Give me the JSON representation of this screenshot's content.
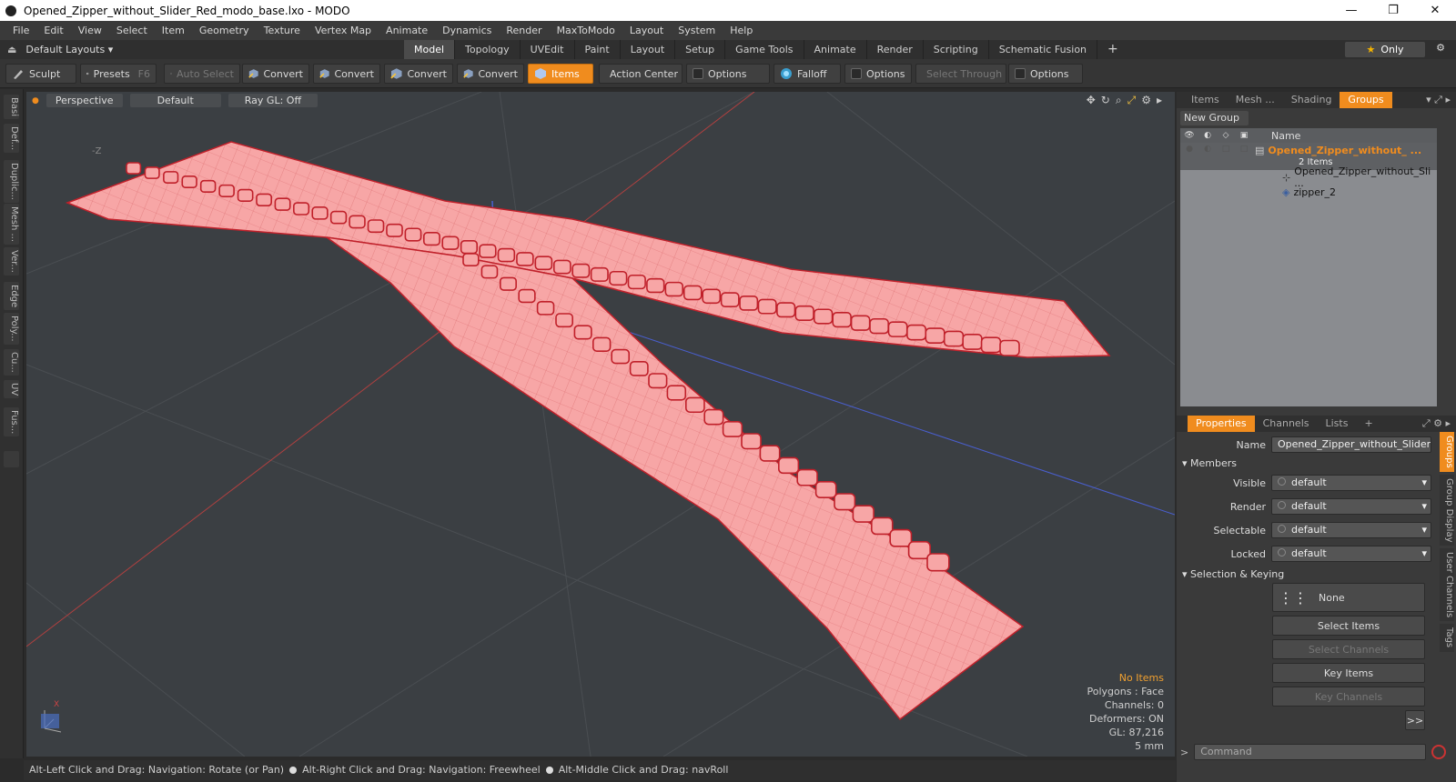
{
  "window": {
    "title": "Opened_Zipper_without_Slider_Red_modo_base.lxo - MODO",
    "minimize": "—",
    "maximize": "❐",
    "close": "✕"
  },
  "menu": [
    "File",
    "Edit",
    "View",
    "Select",
    "Item",
    "Geometry",
    "Texture",
    "Vertex Map",
    "Animate",
    "Dynamics",
    "Render",
    "MaxToModo",
    "Layout",
    "System",
    "Help"
  ],
  "layoutbar": {
    "layout_select": "Default Layouts ▾",
    "tabs": [
      "Model",
      "Topology",
      "UVEdit",
      "Paint",
      "Layout",
      "Setup",
      "Game Tools",
      "Animate",
      "Render",
      "Scripting",
      "Schematic Fusion"
    ],
    "active_tab": "Model",
    "plus": "+",
    "only_label": "Only",
    "star": "★",
    "gear": "⚙"
  },
  "toolbar": {
    "sculpt": "Sculpt",
    "presets": "Presets",
    "presets_key": "F6",
    "auto_select": "Auto Select",
    "convert1": "Convert",
    "convert2": "Convert",
    "convert3": "Convert",
    "convert4": "Convert",
    "items": "Items",
    "action_center": "Action Center",
    "options1": "Options",
    "falloff": "Falloff",
    "options2": "Options",
    "select_through": "Select Through",
    "options3": "Options"
  },
  "left_tabs": [
    "Basi",
    "Def...",
    "Duplic...",
    "Mesh ...",
    "Ver...",
    "Edge",
    "Poly...",
    "Cu...",
    "UV",
    "Fus..."
  ],
  "viewport": {
    "view": "Perspective",
    "shading": "Default",
    "raygl": "Ray GL: Off",
    "axis_label": "-Z",
    "info": {
      "no_items": "No Items",
      "polygons": "Polygons : Face",
      "channels": "Channels: 0",
      "deformers": "Deformers: ON",
      "gl": "GL: 87,216",
      "scale": "5 mm"
    },
    "mesh_color": "#f7a6a6",
    "edge_color": "#c0202a"
  },
  "status": {
    "hint1": "Alt-Left Click and Drag: Navigation: Rotate (or Pan)",
    "hint2": "Alt-Right Click and Drag: Navigation: Freewheel",
    "hint3": "Alt-Middle Click and Drag: navRoll"
  },
  "items_panel": {
    "tabs": [
      "Items",
      "Mesh ...",
      "Shading",
      "Groups"
    ],
    "active_tab": "Groups",
    "new_group": "New Group",
    "column_name": "Name",
    "group_name": "Opened_Zipper_without_ ...",
    "group_count": "2 Items",
    "children": [
      "Opened_Zipper_without_Sli ...",
      "zipper_2"
    ]
  },
  "properties": {
    "tabs": [
      "Properties",
      "Channels",
      "Lists"
    ],
    "active_tab": "Properties",
    "plus": "+",
    "name_label": "Name",
    "name_value": "Opened_Zipper_without_Slider_R",
    "members_label": "Members",
    "visible_label": "Visible",
    "visible_value": "default",
    "render_label": "Render",
    "render_value": "default",
    "selectable_label": "Selectable",
    "selectable_value": "default",
    "locked_label": "Locked",
    "locked_value": "default",
    "selection_label": "Selection & Keying",
    "none_label": "None",
    "select_items": "Select Items",
    "select_channels": "Select Channels",
    "key_items": "Key Items",
    "key_channels": "Key Channels",
    "more": ">>",
    "vertical_tabs": [
      "Groups",
      "Group Display",
      "User Channels",
      "Tags"
    ],
    "active_vtab": "Groups",
    "command_placeholder": "Command",
    "command_arrow": ">"
  }
}
